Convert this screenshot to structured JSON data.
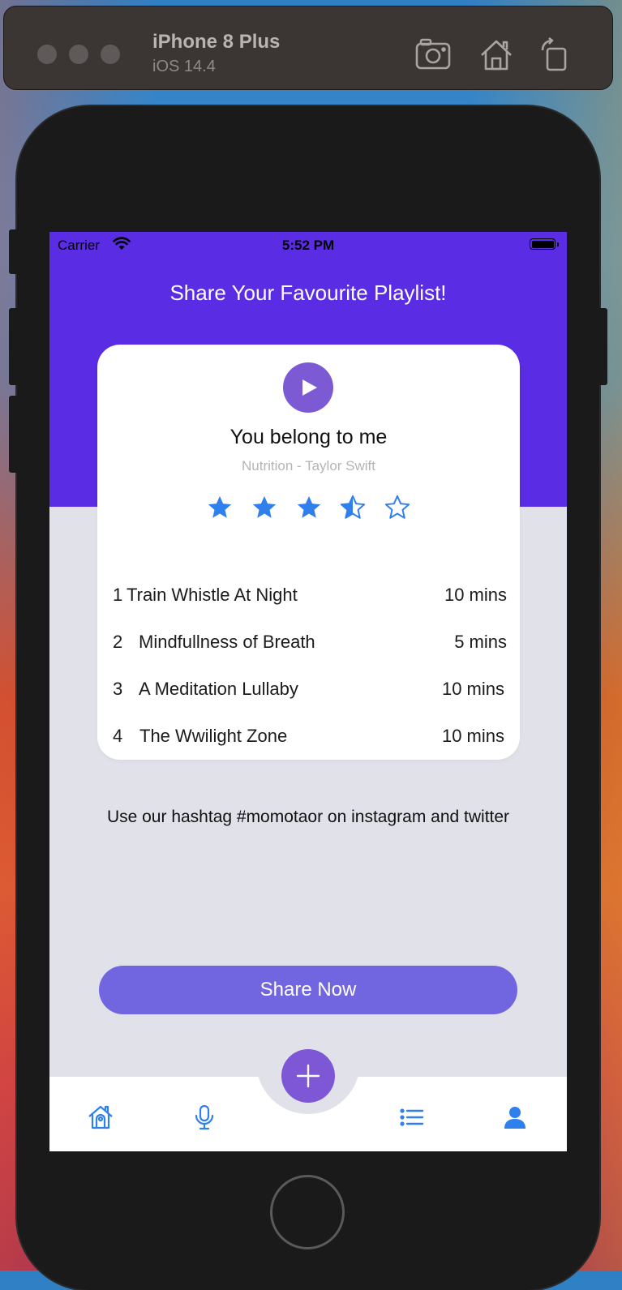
{
  "simulator": {
    "device": "iPhone 8 Plus",
    "os": "iOS 14.4",
    "icons": [
      "screenshot-icon",
      "home-icon",
      "rotate-icon"
    ]
  },
  "status_bar": {
    "carrier": "Carrier",
    "time": "5:52 PM",
    "battery_level": 1.0
  },
  "header": {
    "title": "Share Your Favourite Playlist!"
  },
  "now_playing": {
    "title": "You belong to me",
    "subtitle": "Nutrition - Taylor Swift",
    "rating": 3.5,
    "rating_max": 5
  },
  "tracks": [
    {
      "num": "1",
      "name": "Train Whistle At Night",
      "duration": "10 mins"
    },
    {
      "num": "2",
      "name": "Mindfullness of Breath",
      "duration": "5 mins"
    },
    {
      "num": "3",
      "name": "A Meditation Lullaby",
      "duration": "10 mins"
    },
    {
      "num": "4",
      "name": "The Wwilight Zone",
      "duration": "10 mins"
    }
  ],
  "hashtag_text": "Use our hashtag #momotaor on instagram and twitter",
  "share_button": "Share Now",
  "tab_bar": {
    "items": [
      "home-icon",
      "microphone-icon",
      "add-icon",
      "list-icon",
      "profile-icon"
    ]
  },
  "colors": {
    "header": "#5a2ce4",
    "accent": "#7166df",
    "star": "#2f80ed",
    "tab_icon": "#2f80ed",
    "background": "#e1e1ea"
  }
}
